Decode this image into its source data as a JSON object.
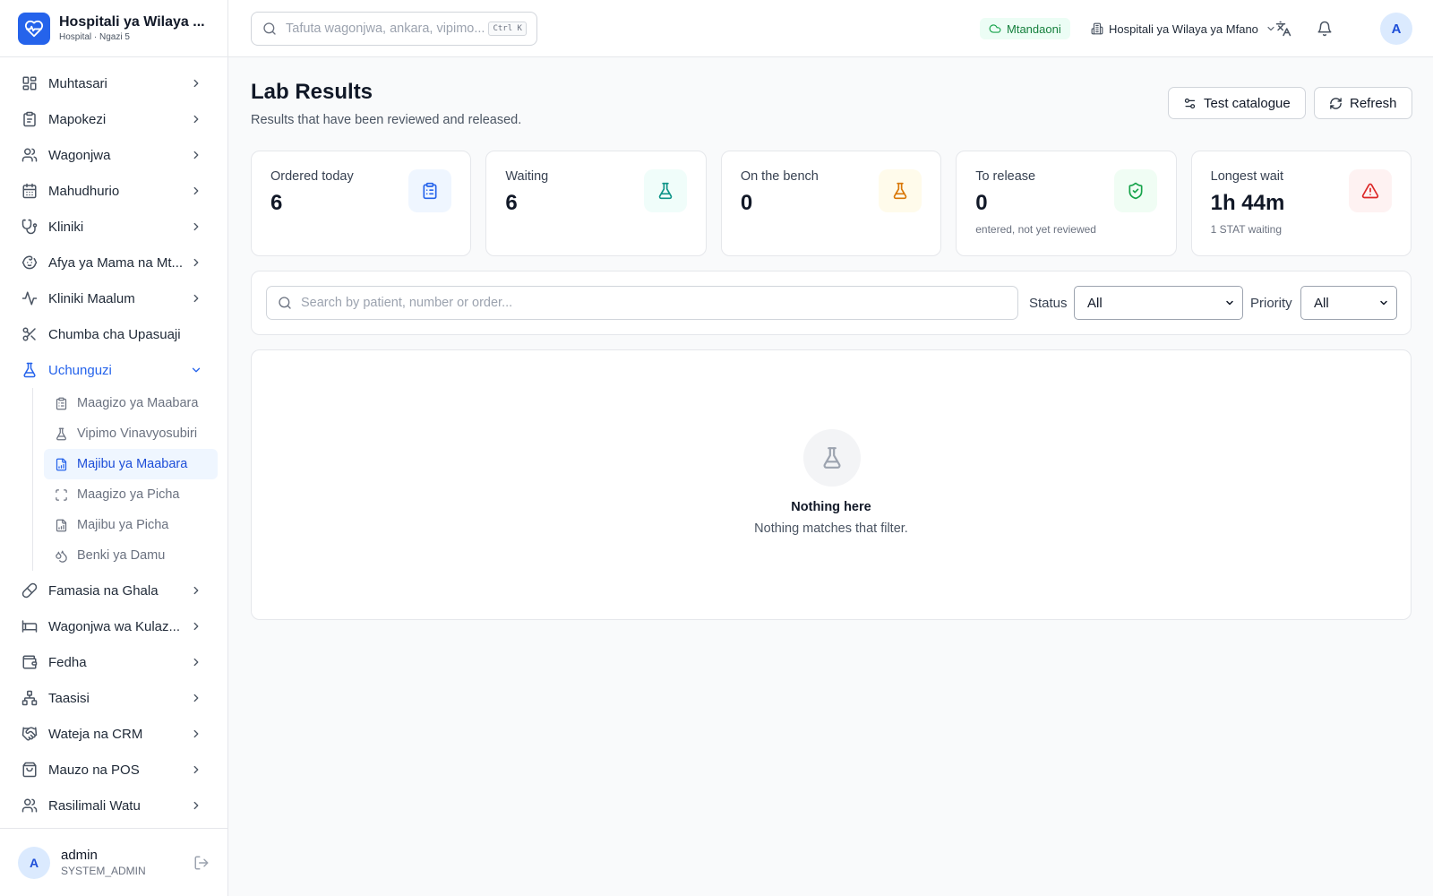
{
  "brand": {
    "title": "Hospitali ya Wilaya ...",
    "subtitle": "Hospital · Ngazi 5"
  },
  "sidebar": {
    "items": [
      {
        "label": "Muhtasari",
        "icon": "dashboard-icon"
      },
      {
        "label": "Mapokezi",
        "icon": "clipboard-icon"
      },
      {
        "label": "Wagonjwa",
        "icon": "users-icon"
      },
      {
        "label": "Mahudhurio",
        "icon": "calendar-icon"
      },
      {
        "label": "Kliniki",
        "icon": "stethoscope-icon"
      },
      {
        "label": "Afya ya Mama na Mt...",
        "icon": "baby-icon"
      },
      {
        "label": "Kliniki Maalum",
        "icon": "activity-icon"
      },
      {
        "label": "Chumba cha Upasuaji",
        "icon": "scissors-icon"
      },
      {
        "label": "Uchunguzi",
        "icon": "flask-icon"
      }
    ],
    "subitems": [
      {
        "label": "Maagizo ya Maabara",
        "icon": "clipboard-list-icon"
      },
      {
        "label": "Vipimo Vinavyosubiri",
        "icon": "flask-icon"
      },
      {
        "label": "Majibu ya Maabara",
        "icon": "file-chart-icon"
      },
      {
        "label": "Maagizo ya Picha",
        "icon": "scan-icon"
      },
      {
        "label": "Majibu ya Picha",
        "icon": "file-chart-icon"
      },
      {
        "label": "Benki ya Damu",
        "icon": "droplets-icon"
      }
    ],
    "items_after": [
      {
        "label": "Famasia na Ghala",
        "icon": "pill-icon"
      },
      {
        "label": "Wagonjwa wa Kulaz...",
        "icon": "bed-icon"
      },
      {
        "label": "Fedha",
        "icon": "wallet-icon"
      },
      {
        "label": "Taasisi",
        "icon": "network-icon"
      },
      {
        "label": "Wateja na CRM",
        "icon": "handshake-icon"
      },
      {
        "label": "Mauzo na POS",
        "icon": "shopping-bag-icon"
      },
      {
        "label": "Rasilimali Watu",
        "icon": "users-icon"
      }
    ]
  },
  "user": {
    "initial": "A",
    "name": "admin",
    "role": "SYSTEM_ADMIN"
  },
  "header": {
    "search_placeholder": "Tafuta wagonjwa, ankara, vipimo...",
    "shortcut": "Ctrl K",
    "status": "Mtandaoni",
    "facility": "Hospitali ya Wilaya ya Mfano",
    "avatar_initial": "A"
  },
  "page": {
    "title": "Lab Results",
    "subtitle": "Results that have been reviewed and released.",
    "catalogue_label": "Test catalogue",
    "refresh_label": "Refresh"
  },
  "stats": [
    {
      "label": "Ordered today",
      "value": "6",
      "note": "",
      "icon": "clipboard-list-icon",
      "color": "#2563eb",
      "bg": "#eff6ff"
    },
    {
      "label": "Waiting",
      "value": "6",
      "note": "",
      "icon": "flask-icon",
      "color": "#0d9488",
      "bg": "#f0fdfa"
    },
    {
      "label": "On the bench",
      "value": "0",
      "note": "",
      "icon": "flask-icon",
      "color": "#d97706",
      "bg": "#fffbeb"
    },
    {
      "label": "To release",
      "value": "0",
      "note": "entered, not yet reviewed",
      "icon": "shield-check-icon",
      "color": "#16a34a",
      "bg": "#f0fdf4"
    },
    {
      "label": "Longest wait",
      "value": "1h 44m",
      "note": "1 STAT waiting",
      "icon": "alert-triangle-icon",
      "color": "#dc2626",
      "bg": "#fef2f2"
    }
  ],
  "filters": {
    "search_placeholder": "Search by patient, number or order...",
    "status_label": "Status",
    "status_value": "All",
    "priority_label": "Priority",
    "priority_value": "All"
  },
  "empty": {
    "title": "Nothing here",
    "text": "Nothing matches that filter."
  }
}
